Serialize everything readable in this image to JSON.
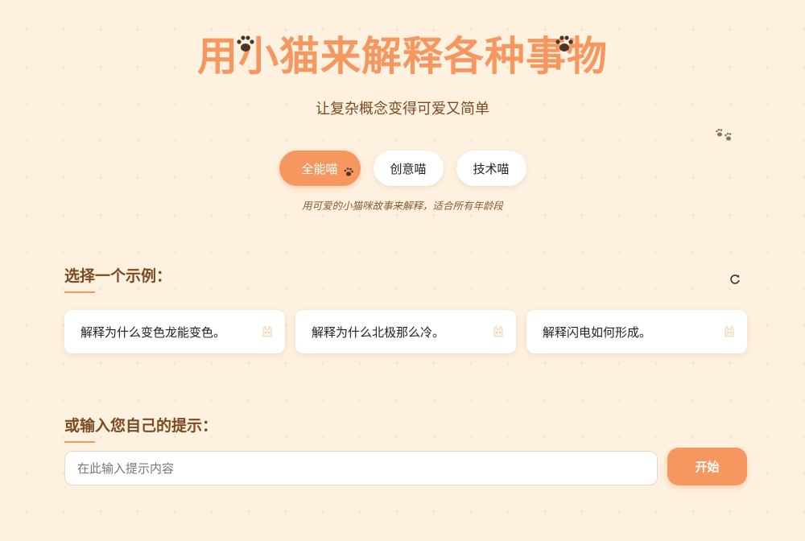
{
  "header": {
    "title": "用小猫来解释各种事物",
    "subtitle": "让复杂概念变得可爱又简单"
  },
  "modes": {
    "items": [
      {
        "label": "全能喵",
        "active": true
      },
      {
        "label": "创意喵",
        "active": false
      },
      {
        "label": "技术喵",
        "active": false
      }
    ],
    "description": "用可爱的小猫咪故事来解释，适合所有年龄段"
  },
  "examples": {
    "title": "选择一个示例：",
    "refresh_icon": "refresh-icon",
    "items": [
      {
        "text": "解释为什么变色龙能变色。",
        "icon": "cat-icon"
      },
      {
        "text": "解释为什么北极那么冷。",
        "icon": "cat-icon"
      },
      {
        "text": "解释闪电如何形成。",
        "icon": "cat-icon"
      }
    ]
  },
  "custom": {
    "title": "或输入您自己的提示：",
    "placeholder": "在此输入提示内容",
    "value": "",
    "start_label": "开始"
  },
  "colors": {
    "accent": "#f5975f",
    "background": "#fff1e0",
    "heading_brown": "#7b4a1f"
  }
}
